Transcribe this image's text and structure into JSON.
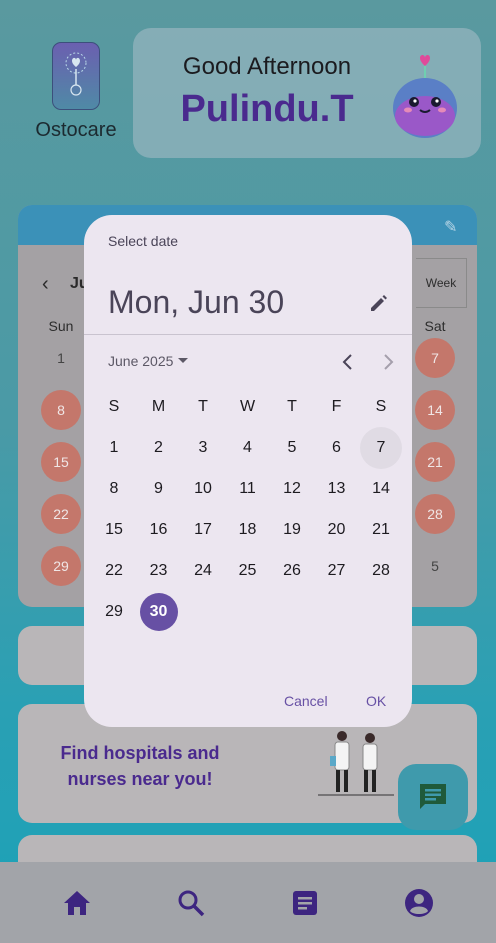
{
  "app": {
    "name": "Ostocare"
  },
  "greeting": {
    "title": "Good Afternoon",
    "name": "Pulindu.T"
  },
  "calendar_card": {
    "month_partial": "Ju",
    "view_button": "Week",
    "weekday_sun": "Sun",
    "weekday_sat": "Sat",
    "sun_days": [
      "1",
      "8",
      "15",
      "22",
      "29"
    ],
    "sat_days": [
      "7",
      "14",
      "21",
      "28",
      "5"
    ]
  },
  "find_card": {
    "text": "Find hospitals and nurses near you!"
  },
  "dialog": {
    "label": "Select date",
    "headline": "Mon, Jun 30",
    "month_year": "June 2025",
    "weekdays": [
      "S",
      "M",
      "T",
      "W",
      "T",
      "F",
      "S"
    ],
    "weeks": [
      [
        "1",
        "2",
        "3",
        "4",
        "5",
        "6",
        "7"
      ],
      [
        "8",
        "9",
        "10",
        "11",
        "12",
        "13",
        "14"
      ],
      [
        "15",
        "16",
        "17",
        "18",
        "19",
        "20",
        "21"
      ],
      [
        "22",
        "23",
        "24",
        "25",
        "26",
        "27",
        "28"
      ],
      [
        "29",
        "30"
      ]
    ],
    "today": "7",
    "selected": "30",
    "cancel": "Cancel",
    "ok": "OK"
  },
  "colors": {
    "accent": "#6750a4",
    "brand_text": "#4a2a8e",
    "dialog_bg": "#ece6f0"
  },
  "nav": {
    "items": [
      {
        "icon": "home-icon"
      },
      {
        "icon": "search-icon"
      },
      {
        "icon": "article-icon"
      },
      {
        "icon": "account-icon"
      }
    ]
  }
}
